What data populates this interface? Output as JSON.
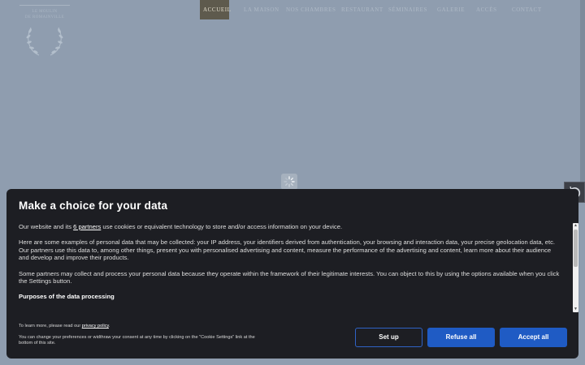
{
  "nav": {
    "items": [
      "Accueil",
      "La Maison",
      "Nos Chambres",
      "Restaurant",
      "Séminaires",
      "Galerie",
      "Accès",
      "Contact"
    ],
    "active_index": 0
  },
  "logo": {
    "line1": "LE MOULIN",
    "line2": "DE ROMAINVILLE",
    "icon": "laurel-wreath-icon"
  },
  "consent": {
    "title": "Make a choice for your data",
    "intro_prefix": "Our website and its ",
    "intro_link": "6 partners",
    "intro_suffix": " use cookies or equivalent technology to store and/or access information on your device.",
    "para2": "Here are some examples of personal data that may be collected: your IP address, your identifiers derived from authentication, your browsing and interaction data, your precise geolocation data, etc.",
    "para3": "Our partners use this data to, among other things, present you with personalised advertising and content, measure the performance of the advertising and content, learn more about their audience and develop and improve their products.",
    "para4": "Some partners may collect and process your personal data because they operate within the framework of their legitimate interests. You can object to this by using the options available when you click the Settings button.",
    "purposes_heading": "Purposes of the data processing",
    "privacy_prefix": "To learn more, please read our ",
    "privacy_link": "privacy policy",
    "privacy_suffix": ".",
    "change_note": "You can change your preferences or widthraw your consent at any time by clicking on the \"Cookie Settings\" link at the bottom of this site.",
    "buttons": {
      "setup": "Set up",
      "refuse": "Refuse all",
      "accept": "Accept all"
    }
  },
  "colors": {
    "page_bg": "#8f9daf",
    "dialog_bg": "#1d1e23",
    "accent": "#1f5bc4",
    "nav_active_bg": "#5e5a4d"
  }
}
